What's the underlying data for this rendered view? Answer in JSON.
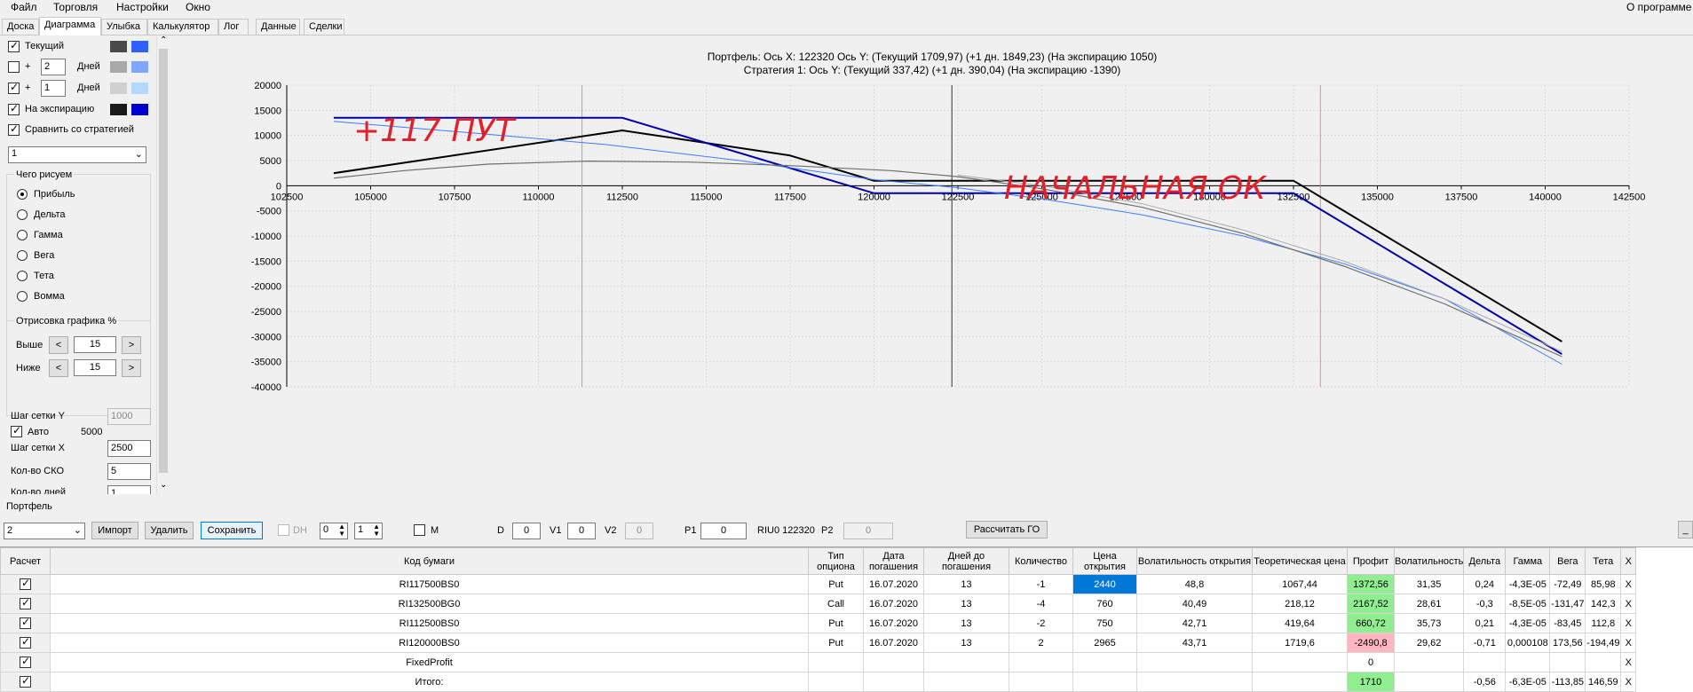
{
  "menu": {
    "file": "Файл",
    "trade": "Торговля",
    "settings": "Настройки",
    "window": "Окно",
    "about": "О программе"
  },
  "tabs": [
    "Доска",
    "Диаграмма",
    "Улыбка",
    "Калькулятор",
    "Лог",
    "Данные",
    "Сделки"
  ],
  "left": {
    "current": "Текущий",
    "plus": "+",
    "days_label": "Дней",
    "days1": "2",
    "days2": "1",
    "expiration": "На экспирацию",
    "compare": "Сравнить со стратегией",
    "strategy_select": "1",
    "what_draw": "Чего рисуем",
    "radios": [
      "Прибыль",
      "Дельта",
      "Гамма",
      "Вега",
      "Тета",
      "Вомма"
    ],
    "draw_group": "Отрисовка графика %",
    "above": "Выше",
    "below": "Ниже",
    "above_val": "15",
    "below_val": "15",
    "lt": "<",
    "gt": ">",
    "grid_y": "Шаг сетки Y",
    "grid_y_val": "1000",
    "auto": "Авто",
    "auto_val": "5000",
    "grid_x": "Шаг сетки X",
    "grid_x_val": "2500",
    "sko": "Кол-во СКО",
    "sko_val": "5",
    "days_count": "Кол-во дней",
    "days_count_val": "1",
    "colors": {
      "current": [
        "#4a4a4a",
        "#2f5fff"
      ],
      "plus2": [
        "#a8a8a8",
        "#7fa7ff"
      ],
      "plus1": [
        "#d0d0d0",
        "#b4d8ff"
      ],
      "expiry": [
        "#1a1a1a",
        "#0000cc"
      ]
    }
  },
  "header": {
    "line1": "Портфель: Ось X: 122320 Ось Y:  (Текущий 1709,97)  (+1 дн. 1849,23)  (На экспирацию 1050)",
    "line2": "Стратегия 1:  Ось Y:  (Текущий 337,42)  (+1 дн. 390,04)  (На экспирацию -1390)"
  },
  "annotations": {
    "left_text": "+117 ПУТ",
    "right_text": "НАЧАЛЬНАЯ ОК"
  },
  "chart_data": {
    "type": "line",
    "xlim": [
      102500,
      142500
    ],
    "ylim": [
      -40000,
      20000
    ],
    "x_ticks": [
      102500,
      105000,
      107500,
      110000,
      112500,
      115000,
      117500,
      120000,
      122500,
      125000,
      127500,
      130000,
      132500,
      135000,
      137500,
      140000,
      142500
    ],
    "y_ticks": [
      20000,
      15000,
      10000,
      5000,
      0,
      -5000,
      -10000,
      -15000,
      -20000,
      -25000,
      -30000,
      -35000,
      -40000
    ],
    "grid": true,
    "cursor_x": 122320,
    "sko_lines": [
      111300,
      133300
    ],
    "series": [
      {
        "color": "#000000",
        "points": [
          [
            103900,
            2500
          ],
          [
            112500,
            11000
          ],
          [
            117500,
            6000
          ],
          [
            120000,
            1000
          ],
          [
            132500,
            1000
          ],
          [
            140500,
            -31000
          ]
        ]
      },
      {
        "color": "#0000aa",
        "points": [
          [
            103900,
            13500
          ],
          [
            112500,
            13500
          ],
          [
            120000,
            -1500
          ],
          [
            132500,
            -1500
          ],
          [
            140500,
            -33500
          ]
        ]
      },
      {
        "color": "#3b7dff",
        "points": [
          [
            103900,
            12800
          ],
          [
            108000,
            10500
          ],
          [
            112000,
            8200
          ],
          [
            116000,
            5000
          ],
          [
            120000,
            1200
          ],
          [
            122500,
            -400
          ],
          [
            125000,
            -2600
          ],
          [
            128000,
            -5800
          ],
          [
            131000,
            -10000
          ],
          [
            134000,
            -15500
          ],
          [
            137000,
            -22500
          ],
          [
            140500,
            -35500
          ]
        ]
      },
      {
        "color": "#6e6e6e",
        "points": [
          [
            103900,
            1500
          ],
          [
            106000,
            3000
          ],
          [
            108500,
            4300
          ],
          [
            111500,
            4900
          ],
          [
            114500,
            4700
          ],
          [
            117500,
            4000
          ],
          [
            120500,
            3000
          ],
          [
            122500,
            1800
          ],
          [
            125000,
            -600
          ],
          [
            128000,
            -4300
          ],
          [
            131000,
            -9500
          ],
          [
            134000,
            -16000
          ],
          [
            137000,
            -23500
          ],
          [
            140500,
            -34000
          ]
        ]
      },
      {
        "color": "#a8a8a8",
        "points": [
          [
            122500,
            2100
          ],
          [
            125000,
            0
          ],
          [
            128000,
            -3600
          ],
          [
            131000,
            -8800
          ],
          [
            134000,
            -15000
          ],
          [
            137000,
            -22500
          ],
          [
            140500,
            -33000
          ]
        ]
      }
    ]
  },
  "portfolio": {
    "label": "Портфель",
    "select": "2",
    "import": "Импорт",
    "delete": "Удалить",
    "save": "Сохранить",
    "dh": "DH",
    "dh1": "0",
    "dh2": "1",
    "m": "M",
    "d_label": "D",
    "d_val": "0",
    "v1_label": "V1",
    "v1_val": "0",
    "v2_label": "V2",
    "v2_val": "0",
    "p1_label": "P1",
    "p1_val": "0",
    "riu": "RIU0 122320",
    "p2_label": "P2",
    "p2_val": "0",
    "calc": "Рассчитать ГО",
    "min": "_"
  },
  "table": {
    "headers": [
      "Расчет",
      "Код бумаги",
      "Тип опциона",
      "Дата погашения",
      "Дней до погашения",
      "Количество",
      "Цена открытия",
      "Волатильность открытия",
      "Теоретическая цена",
      "Профит",
      "Волатильность",
      "Дельта",
      "Гамма",
      "Вега",
      "Тета",
      "X"
    ],
    "rows": [
      [
        "RI117500BS0",
        "Put",
        "16.07.2020",
        "13",
        "-1",
        "2440",
        "48,8",
        "1067,44",
        "1372,56",
        "31,35",
        "0,24",
        "-4,3E-05",
        "-72,49",
        "85,98",
        "X"
      ],
      [
        "RI132500BG0",
        "Call",
        "16.07.2020",
        "13",
        "-4",
        "760",
        "40,49",
        "218,12",
        "2167,52",
        "28,61",
        "-0,3",
        "-8,5E-05",
        "-131,47",
        "142,3",
        "X"
      ],
      [
        "RI112500BS0",
        "Put",
        "16.07.2020",
        "13",
        "-2",
        "750",
        "42,71",
        "419,64",
        "660,72",
        "35,73",
        "0,21",
        "-4,3E-05",
        "-83,45",
        "112,8",
        "X"
      ],
      [
        "RI120000BS0",
        "Put",
        "16.07.2020",
        "13",
        "2",
        "2965",
        "43,71",
        "1719,6",
        "-2490,8",
        "29,62",
        "-0,71",
        "0,000108",
        "173,56",
        "-194,49",
        "X"
      ],
      [
        "FixedProfit",
        "",
        "",
        "",
        "",
        "",
        "",
        "",
        "0",
        "",
        "",
        "",
        "",
        "",
        "X"
      ],
      [
        "Итого:",
        "",
        "",
        "",
        "",
        "",
        "",
        "",
        "1710",
        "",
        "-0,56",
        "-6,3E-05",
        "-113,85",
        "146,59",
        "X"
      ]
    ]
  }
}
